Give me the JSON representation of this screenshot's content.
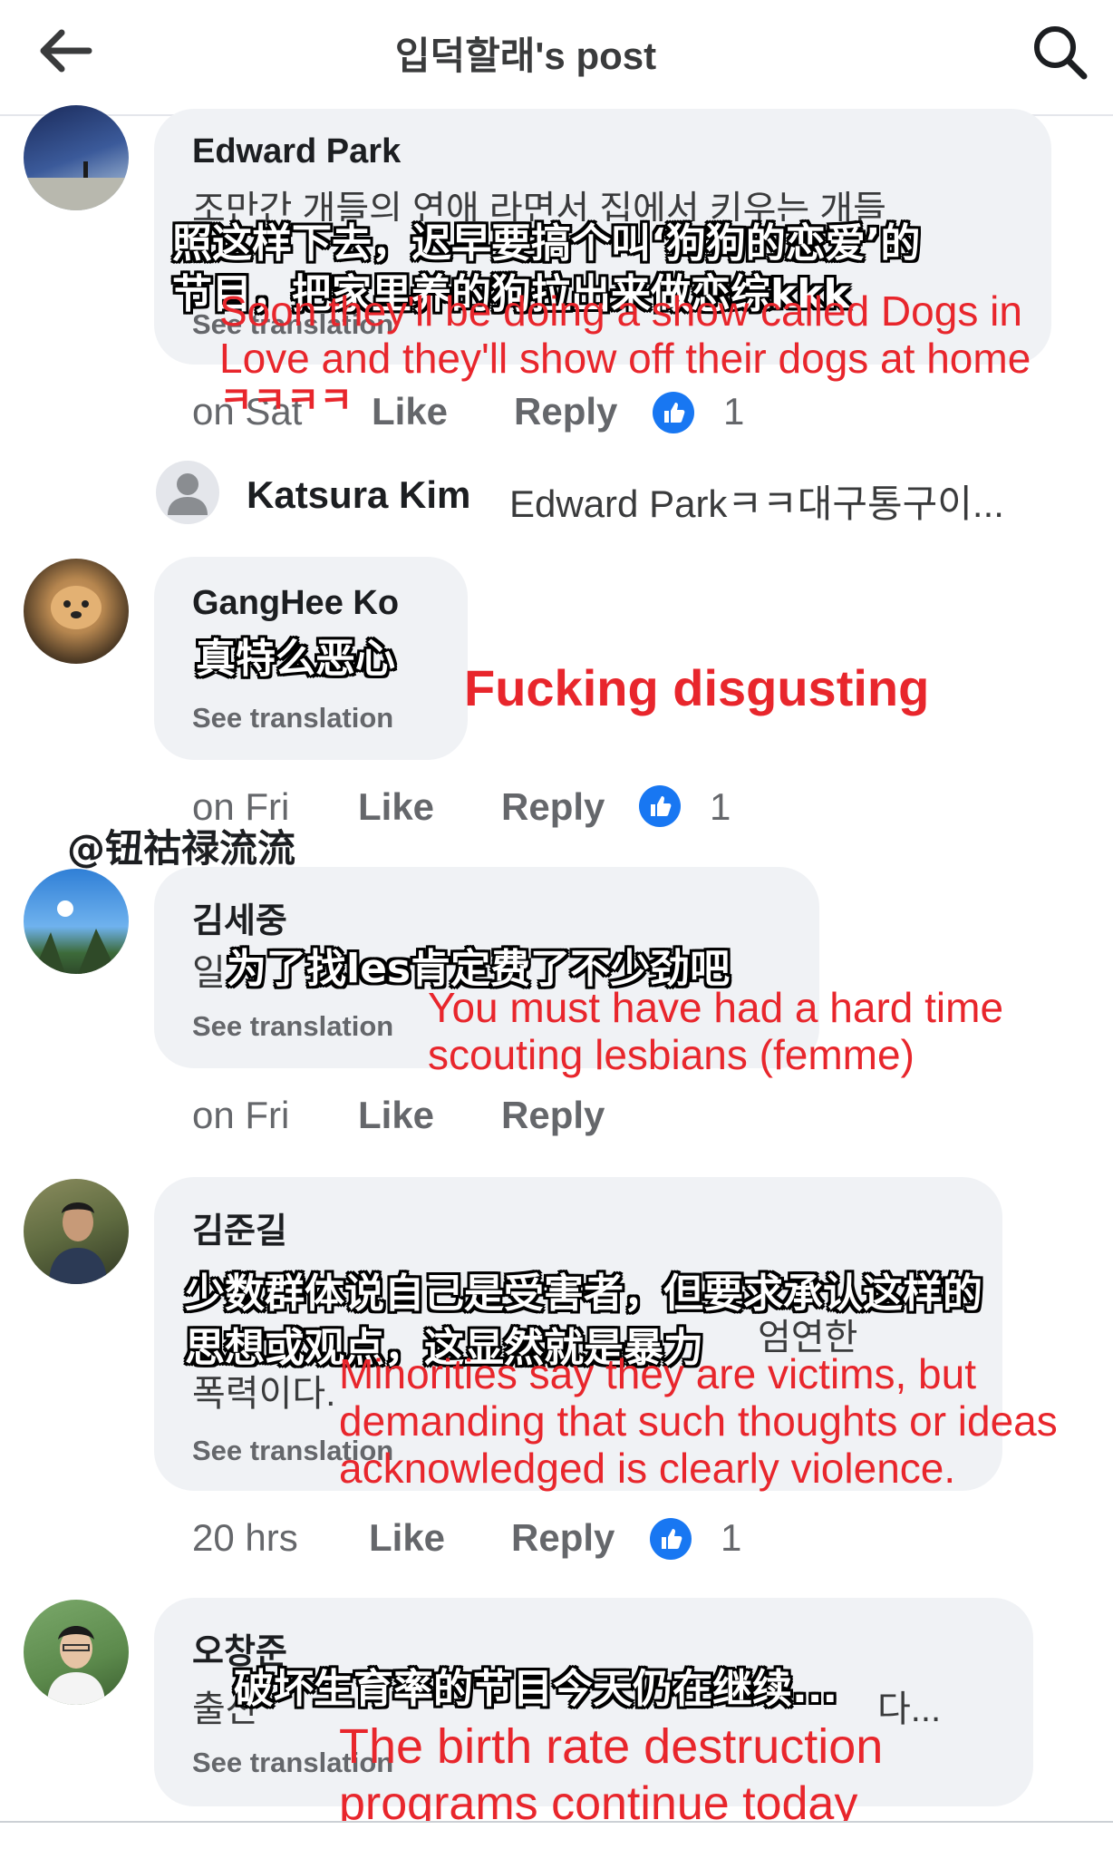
{
  "header": {
    "title": "입덕할래's post",
    "back_icon": "back-arrow-icon",
    "search_icon": "search-icon"
  },
  "comments": [
    {
      "author": "Edward Park",
      "text": "조만간 개들의 연애 라면서 집에서 키우는 개들",
      "see_translation": "See translation",
      "time": "on Sat",
      "like": "Like",
      "reply": "Reply",
      "reactions": "1",
      "zh_line1": "照这样下去，迟早要搞个叫‘狗狗的恋爱’的",
      "zh_line2": "节目，把家里养的狗拉出来做恋综kkk",
      "en_line1": "Soon they'll be doing a show called Dogs in",
      "en_line2": "Love and they'll show off their dogs at home",
      "en_line3": "ㅋㅋㅋㅋ"
    },
    {
      "author": "Katsura Kim",
      "preview": "Edward Parkㅋㅋ대구통구이..."
    },
    {
      "author": "GangHee Ko",
      "see_translation": "See translation",
      "time": "on Fri",
      "like": "Like",
      "reply": "Reply",
      "reactions": "1",
      "zh_line1": "真特么恶心",
      "en_line1": "Fucking disgusting"
    },
    {
      "author": "김세중",
      "text": "일",
      "see_translation": "See translation",
      "time": "on Fri",
      "like": "Like",
      "reply": "Reply",
      "zh_line1": "为了找les肯定费了不少劲吧",
      "en_line1": "You must have had a hard time",
      "en_line2": "scouting lesbians (femme)"
    },
    {
      "author": "김준길",
      "text1": "엄연한",
      "text2": "폭력이다.",
      "see_translation": "See translation",
      "time": "20 hrs",
      "like": "Like",
      "reply": "Reply",
      "reactions": "1",
      "zh_line1": "少数群体说自己是受害者，但要求承认这样的",
      "zh_line2": "思想或观点，这显然就是暴力",
      "en_line1": "Minorities say they are victims, but",
      "en_line2": "demanding that such thoughts or ideas",
      "en_line3": "acknowledged is clearly violence."
    },
    {
      "author": "오창준",
      "text": "출산",
      "text_end": "다...",
      "see_translation": "See translation",
      "zh_line1": "破坏生育率的节目今天仍在继续...",
      "en_line1": "The birth rate destruction",
      "en_line2": "programs continue today"
    }
  ],
  "watermark": "@钮祜禄流流",
  "colors": {
    "overlay_red": "#e8262c",
    "like_blue": "#1877f2",
    "bubble": "#f0f2f5",
    "meta_gray": "#65676b"
  }
}
